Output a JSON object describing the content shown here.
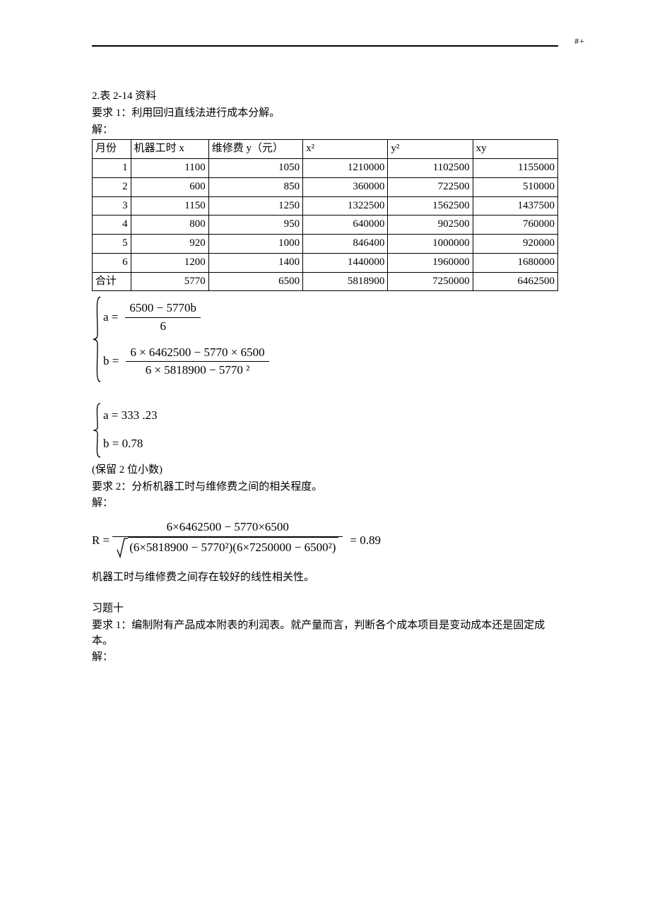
{
  "header_mark": "#+",
  "intro": {
    "line1": "2.表 2-14 资料",
    "req1": "要求 1：利用回归直线法进行成本分解。",
    "sol_label": "解："
  },
  "table": {
    "headers": {
      "c1": "月份",
      "c2": "机器工时 x",
      "c3": "维修费 y（元）",
      "c4": "x²",
      "c5": "y²",
      "c6": "xy"
    },
    "rows": [
      {
        "c1": "1",
        "c2": "1100",
        "c3": "1050",
        "c4": "1210000",
        "c5": "1102500",
        "c6": "1155000"
      },
      {
        "c1": "2",
        "c2": "600",
        "c3": "850",
        "c4": "360000",
        "c5": "722500",
        "c6": "510000"
      },
      {
        "c1": "3",
        "c2": "1150",
        "c3": "1250",
        "c4": "1322500",
        "c5": "1562500",
        "c6": "1437500"
      },
      {
        "c1": "4",
        "c2": "800",
        "c3": "950",
        "c4": "640000",
        "c5": "902500",
        "c6": "760000"
      },
      {
        "c1": "5",
        "c2": "920",
        "c3": "1000",
        "c4": "846400",
        "c5": "1000000",
        "c6": "920000"
      },
      {
        "c1": "6",
        "c2": "1200",
        "c3": "1400",
        "c4": "1440000",
        "c5": "1960000",
        "c6": "1680000"
      }
    ],
    "total": {
      "c1": "合计",
      "c2": "5770",
      "c3": "6500",
      "c4": "5818900",
      "c5": "7250000",
      "c6": "6462500"
    }
  },
  "eq1": {
    "a_lhs": "a =",
    "a_num": "6500  − 5770b",
    "a_den": "6",
    "b_lhs": "b =",
    "b_num": "6 × 6462500  − 5770  × 6500",
    "b_den": "6 × 5818900  − 5770 ²"
  },
  "eq2": {
    "a": "a = 333 .23",
    "b": "b = 0.78"
  },
  "note_round": "(保留 2 位小数)",
  "req2": "要求 2：分析机器工时与维修费之间的相关程度。",
  "sol_label2": "解：",
  "R": {
    "lhs": "R =",
    "num": "6×6462500 − 5770×6500",
    "den_inside": "(6×5818900 − 5770²)(6×7250000 − 6500²)",
    "rhs": "= 0.89"
  },
  "conclusion": "机器工时与维修费之间存在较好的线性相关性。",
  "ex10": {
    "title": "习题十",
    "req1": "要求 1：编制附有产品成本附表的利润表。就产量而言，判断各个成本项目是变动成本还是固定成本。",
    "sol": "解："
  },
  "chart_data": {
    "type": "table",
    "title": "表 2-14 资料",
    "columns": [
      "月份",
      "机器工时 x",
      "维修费 y（元）",
      "x²",
      "y²",
      "xy"
    ],
    "rows": [
      [
        1,
        1100,
        1050,
        1210000,
        1102500,
        1155000
      ],
      [
        2,
        600,
        850,
        360000,
        722500,
        510000
      ],
      [
        3,
        1150,
        1250,
        1322500,
        1562500,
        1437500
      ],
      [
        4,
        800,
        950,
        640000,
        902500,
        760000
      ],
      [
        5,
        920,
        1000,
        846400,
        1000000,
        920000
      ],
      [
        6,
        1200,
        1400,
        1440000,
        1960000,
        1680000
      ]
    ],
    "totals": [
      "合计",
      5770,
      6500,
      5818900,
      7250000,
      6462500
    ],
    "regression": {
      "a": 333.23,
      "b": 0.78,
      "R": 0.89
    }
  }
}
